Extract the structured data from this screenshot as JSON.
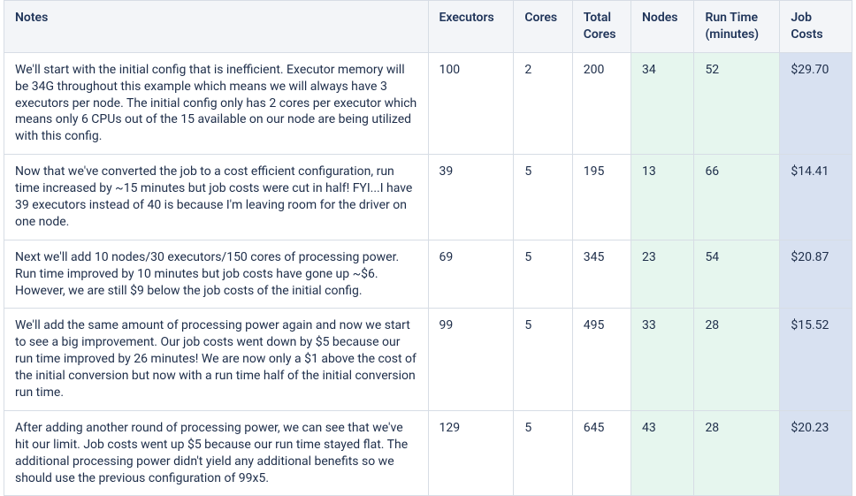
{
  "headers": {
    "notes": "Notes",
    "executors": "Executors",
    "cores": "Cores",
    "tcores": "Total Cores",
    "nodes": "Nodes",
    "runtime": "Run Time (minutes)",
    "costs": "Job Costs"
  },
  "rows": [
    {
      "notes": "We'll start with the initial config that is inefficient.  Executor memory will be 34G throughout this example which means we will always have 3 executors per node.  The initial config only has 2 cores per executor which means only 6 CPUs out of the 15 available on our node are being utilized with this config.",
      "executors": "100",
      "cores": "2",
      "tcores": "200",
      "nodes": "34",
      "runtime": "52",
      "costs": "$29.70"
    },
    {
      "notes": "Now that we've converted the job to a cost efficient configuration, run time increased by ~15 minutes but job costs were cut in half!  FYI...I have 39 executors instead of 40 is because I'm leaving room for the driver on one node.",
      "executors": "39",
      "cores": "5",
      "tcores": "195",
      "nodes": "13",
      "runtime": "66",
      "costs": "$14.41"
    },
    {
      "notes": "Next we'll add 10 nodes/30 executors/150 cores of processing power.   Run time improved by 10 minutes but job costs have gone up ~$6.  However, we are still $9 below the job costs of the initial config.",
      "executors": "69",
      "cores": "5",
      "tcores": "345",
      "nodes": "23",
      "runtime": "54",
      "costs": "$20.87"
    },
    {
      "notes": "We'll add the same amount of processing power again and now we start to see a big improvement.  Our job costs went down by $5 because our run time improved by 26 minutes!  We are now only a $1 above the cost of the initial conversion but now with a run time half of the initial conversion run time.",
      "executors": "99",
      "cores": "5",
      "tcores": "495",
      "nodes": "33",
      "runtime": "28",
      "costs": "$15.52"
    },
    {
      "notes": "After adding another round of processing power, we can see that we've hit our limit.  Job costs went up $5 because our run time stayed flat. The additional processing power didn't yield any additional benefits so we should use the previous configuration of 99x5.",
      "executors": "129",
      "cores": "5",
      "tcores": "645",
      "nodes": "43",
      "runtime": "28",
      "costs": "$20.23"
    }
  ]
}
